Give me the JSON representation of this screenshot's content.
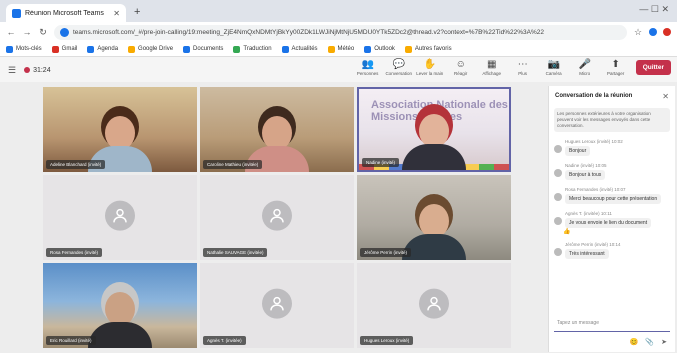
{
  "browser": {
    "tab_title": "Réunion Microsoft Teams",
    "tab_close": "✕",
    "new_tab": "+",
    "window_controls": "—  ☐  ✕",
    "back": "←",
    "forward": "→",
    "reload": "↻",
    "url": "teams.microsoft.com/_#/pre-join-calling/19:meeting_ZjE4NmQxNDMtYjBkYy00ZDk1LWJiNjMtNjU5MDU0YTk5ZDc2@thread.v2?context=%7B%22Tid%22%3A%22",
    "star": "☆"
  },
  "bookmarks": [
    {
      "label": "Mots-clés",
      "color": "#1a73e8"
    },
    {
      "label": "Gmail",
      "color": "#d93025"
    },
    {
      "label": "Agenda",
      "color": "#1a73e8"
    },
    {
      "label": "Google Drive",
      "color": "#f9ab00"
    },
    {
      "label": "Documents",
      "color": "#1a73e8"
    },
    {
      "label": "Traduction",
      "color": "#34a853"
    },
    {
      "label": "Actualités",
      "color": "#1a73e8"
    },
    {
      "label": "Météo",
      "color": "#f9ab00"
    },
    {
      "label": "Outlook",
      "color": "#1a73e8"
    },
    {
      "label": "Autres favoris",
      "color": "#f9ab00"
    }
  ],
  "meeting": {
    "timer": "31:24",
    "tools": [
      {
        "icon": "👥",
        "label": "Personnes"
      },
      {
        "icon": "💬",
        "label": "Conversation"
      },
      {
        "icon": "✋",
        "label": "Lever la main"
      },
      {
        "icon": "☺",
        "label": "Réagir"
      },
      {
        "icon": "▦",
        "label": "Affichage"
      },
      {
        "icon": "⋯",
        "label": "Plus"
      },
      {
        "icon": "📷",
        "label": "Caméra"
      },
      {
        "icon": "🎤",
        "label": "Micro"
      },
      {
        "icon": "⬆",
        "label": "Partager"
      }
    ],
    "leave_label": "Quitter"
  },
  "participants": [
    {
      "name": "Adeline Blanchard (invité)",
      "type": "video1",
      "skin": "#d9a78a",
      "hair": "#4a2b1a",
      "shirt": "#9fb6c9"
    },
    {
      "name": "Caroline Mathieu (invitée)",
      "type": "video2",
      "skin": "#d6a488",
      "hair": "#3e2a1e",
      "shirt": "#cf8f86"
    },
    {
      "name": "Nadine (invité)",
      "type": "video3",
      "skin": "#e2b39a",
      "hair": "#b4333a",
      "shirt": "#30303a"
    },
    {
      "name": "Rosa Fernandes (invité)",
      "type": "avatar"
    },
    {
      "name": "Nathalie SAUVAGE (invitée)",
      "type": "avatar"
    },
    {
      "name": "Jérôme Perrin (invité)",
      "type": "video4",
      "skin": "#d9ad8f",
      "hair": "#6b4b30",
      "shirt": "#2f3b45"
    },
    {
      "name": "Eric Rouillard (invité)",
      "type": "video5",
      "skin": "#caa184",
      "hair": "#c7c7c7",
      "shirt": "#2c2c30"
    },
    {
      "name": "Agnès T. (invitée)",
      "type": "avatar"
    },
    {
      "name": "Hugues Leroux (invité)",
      "type": "avatar"
    }
  ],
  "banner_text": "Association Nationale des Missions Locales",
  "chat": {
    "title": "Conversation de la réunion",
    "close": "✕",
    "notice": "Les personnes extérieures à votre organisation peuvent voir les messages envoyés dans cette conversation.",
    "messages": [
      {
        "meta": "Hugues Leroux (invité)  10:02",
        "text": "Bonjour"
      },
      {
        "meta": "Nadine (invité)  10:05",
        "text": "Bonjour à tous"
      },
      {
        "meta": "Rosa Fernandes (invité)  10:07",
        "text": "Merci beaucoup pour cette présentation"
      },
      {
        "meta": "Agnès T. (invitée)  10:11",
        "text": "Je vous envoie le lien du document"
      },
      {
        "meta": "Jérôme Perrin (invité)  10:14",
        "text": "Très intéressant"
      }
    ],
    "reaction": "👍",
    "compose_placeholder": "Tapez un message",
    "compose_tools": [
      "😊",
      "📎",
      "➤"
    ]
  }
}
